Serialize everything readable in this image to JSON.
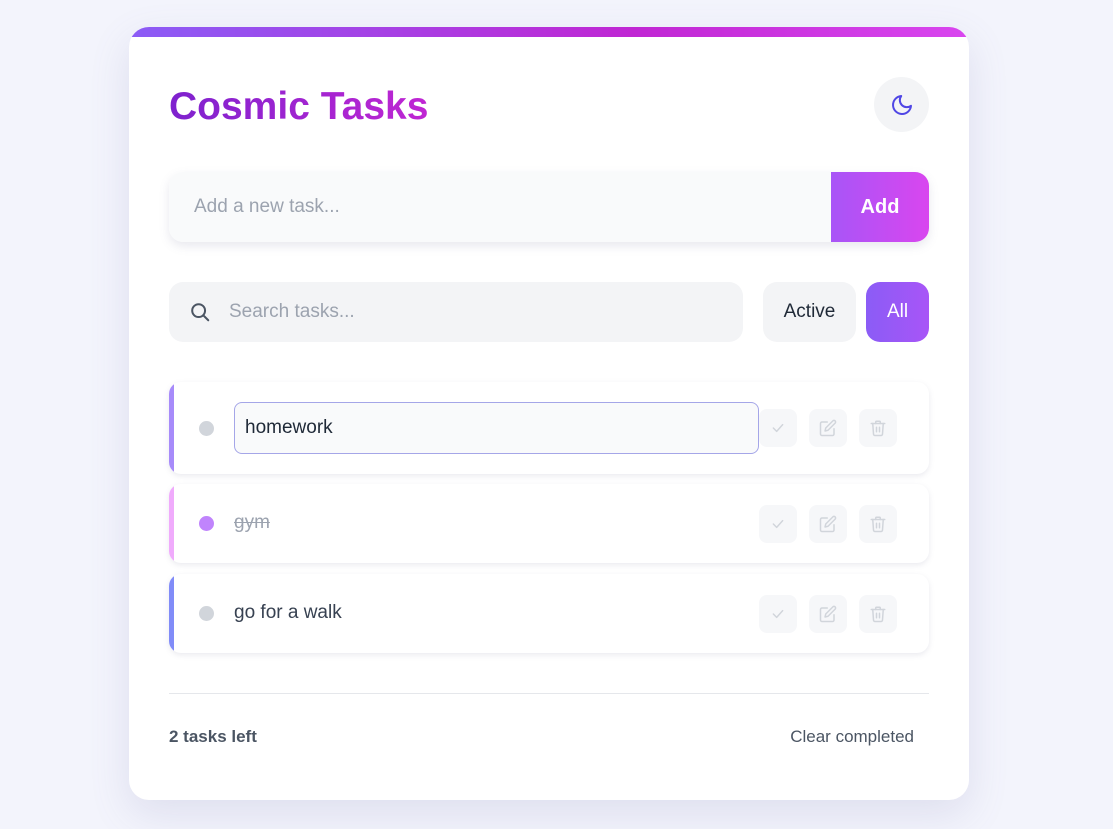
{
  "app": {
    "title": "Cosmic Tasks",
    "theme_icon": "moon-icon"
  },
  "add_task": {
    "placeholder": "Add a new task...",
    "value": "",
    "button_label": "Add"
  },
  "search": {
    "placeholder": "Search tasks...",
    "value": "",
    "icon": "search-icon"
  },
  "filters": [
    {
      "label": "Active",
      "selected": false
    },
    {
      "label": "All",
      "selected": true
    }
  ],
  "tasks": [
    {
      "text": "homework",
      "completed": false,
      "editing": true,
      "accent": "#a78bfa",
      "dot": "#d1d5db"
    },
    {
      "text": "gym",
      "completed": true,
      "editing": false,
      "accent": "#f0abfc",
      "dot": "#c084fc"
    },
    {
      "text": "go for a walk",
      "completed": false,
      "editing": false,
      "accent": "#818cf8",
      "dot": "#d1d5db"
    }
  ],
  "task_actions": [
    "check-icon",
    "edit-icon",
    "trash-icon"
  ],
  "footer": {
    "tasks_left": "2 tasks left",
    "clear_label": "Clear completed"
  },
  "colors": {
    "brand_start": "#7e22ce",
    "brand_end": "#d946ef",
    "filter_selected": "#8b5cf6",
    "background": "#f3f4fc"
  }
}
